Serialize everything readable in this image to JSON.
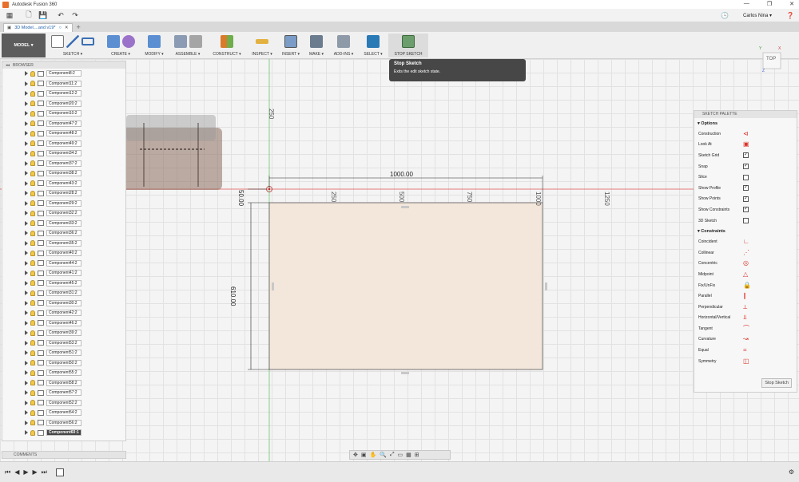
{
  "app": {
    "title": "Autodesk Fusion 360",
    "user": "Carlos Nina ▾",
    "doc_tab": "3D Model....and v19*",
    "workspace": "MODEL ▾"
  },
  "ribbon": {
    "groups": [
      "SKETCH ▾",
      "CREATE ▾",
      "MODIFY ▾",
      "ASSEMBLE ▾",
      "CONSTRUCT ▾",
      "INSPECT ▾",
      "INSERT ▾",
      "MAKE ▾",
      "ADD-INS ▾",
      "SELECT ▾",
      "STOP SKETCH"
    ]
  },
  "tooltip": {
    "title": "Stop Sketch",
    "desc": "Exits the edit sketch state."
  },
  "viewcube": {
    "face": "TOP",
    "x": "X",
    "y": "Y",
    "z": "Z"
  },
  "browser": {
    "title": "BROWSER",
    "items": [
      "Component8:2",
      "Component11:2",
      "Component12:2",
      "Component20:2",
      "Component10:2",
      "Component47:2",
      "Component48:2",
      "Component49:2",
      "Component34:2",
      "Component37:2",
      "Component38:2",
      "Component43:2",
      "Component28:2",
      "Component29:2",
      "Component32:2",
      "Component33:2",
      "Component36:2",
      "Component35:2",
      "Component40:2",
      "Component44:2",
      "Component41:2",
      "Component45:2",
      "Component31:2",
      "Component30:2",
      "Component42:2",
      "Component46:2",
      "Component39:2",
      "Component53:2",
      "Component51:2",
      "Component50:2",
      "Component55:2",
      "Component58:2",
      "Component57:2",
      "Component52:2",
      "Component54:2",
      "Component56:2",
      "Component60:1"
    ],
    "active_index": 36
  },
  "comments": {
    "label": "COMMENTS"
  },
  "palette": {
    "title": "SKETCH PALETTE",
    "options_label": "Options",
    "options": [
      {
        "label": "Construction",
        "icon": "construction-icon"
      },
      {
        "label": "Look At",
        "icon": "look-at-icon"
      },
      {
        "label": "Sketch Grid",
        "checked": true
      },
      {
        "label": "Snap",
        "checked": true
      },
      {
        "label": "Slice",
        "checked": false
      },
      {
        "label": "Show Profile",
        "checked": true
      },
      {
        "label": "Show Points",
        "checked": true
      },
      {
        "label": "Show Constraints",
        "checked": true
      },
      {
        "label": "3D Sketch",
        "checked": false
      }
    ],
    "constraints_label": "Constraints",
    "constraints": [
      {
        "label": "Coincident",
        "glyph": "∟"
      },
      {
        "label": "Collinear",
        "glyph": "⋰"
      },
      {
        "label": "Concentric",
        "glyph": "◎"
      },
      {
        "label": "Midpoint",
        "glyph": "△"
      },
      {
        "label": "Fix/UnFix",
        "glyph": "🔒"
      },
      {
        "label": "Parallel",
        "glyph": "∥"
      },
      {
        "label": "Perpendicular",
        "glyph": "⟂"
      },
      {
        "label": "Horizontal/Vertical",
        "glyph": "⫫"
      },
      {
        "label": "Tangent",
        "glyph": "⌒"
      },
      {
        "label": "Curvature",
        "glyph": "↝"
      },
      {
        "label": "Equal",
        "glyph": "="
      },
      {
        "label": "Symmetry",
        "glyph": "◫"
      }
    ],
    "stop_button": "Stop Sketch"
  },
  "sketch": {
    "dim_width": "1000.00",
    "dim_height": "610.00",
    "dim_offset": "50.00",
    "ruler_ticks": [
      "250",
      "500",
      "750",
      "1000",
      "1250"
    ],
    "ruler_vertical": "250"
  },
  "colors": {
    "accent": "#1f5fa8",
    "sketch_fill": "#f3e6da",
    "axis_red": "#e0524f",
    "axis_green": "#6fc36f"
  }
}
